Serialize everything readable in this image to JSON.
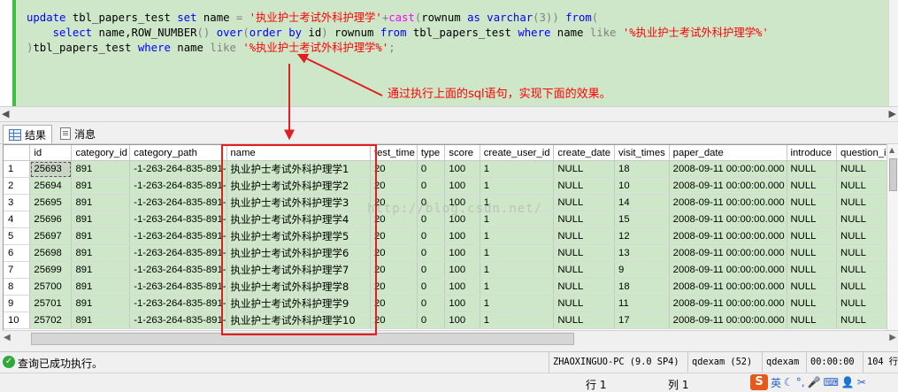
{
  "editor": {
    "line1": {
      "kw_update": "update",
      "table": " tbl_papers_test ",
      "kw_set": "set",
      "name_col": " name ",
      "eq": "=",
      "space": " ",
      "str": "'执业护士考试外科护理学'",
      "plus": "+",
      "fn_cast": "cast",
      "paren_open": "(",
      "rownum": "rownum ",
      "kw_as": "as",
      "varchar_sp": " ",
      "kw_varchar": "varchar",
      "varchar_arg": "(3)) ",
      "kw_from": "from",
      "paren_open2": "("
    },
    "line2": {
      "indent": "    ",
      "kw_select": "select",
      "cols": " name,ROW_NUMBER",
      "parens": "() ",
      "kw_over": "over",
      "p_open": "(",
      "kw_order": "order",
      "sp1": " ",
      "kw_by": "by",
      "id_part": " id",
      "p_close": ")",
      "rownum_alias": " rownum ",
      "kw_from": "from",
      "table": " tbl_papers_test ",
      "kw_where": "where",
      "name_col": " name ",
      "kw_like": "like",
      "sp2": " ",
      "str": "'%执业护士考试外科护理学%'"
    },
    "line3": {
      "p_close": ")",
      "table": "tbl_papers_test ",
      "kw_where": "where",
      "name_col": " name ",
      "kw_like": "like",
      "sp": " ",
      "str": "'%执业护士考试外科护理学%'",
      "semi": ";"
    },
    "annotation": "通过执行上面的sql语句，实现下面的效果。"
  },
  "tabs": {
    "results": "结果",
    "messages": "消息"
  },
  "grid": {
    "columns": [
      "id",
      "category_id",
      "category_path",
      "name",
      "test_time",
      "type",
      "score",
      "create_user_id",
      "create_date",
      "visit_times",
      "paper_date",
      "introduce",
      "question_ids"
    ],
    "rows": [
      [
        "1",
        "25693",
        "891",
        "-1-263-264-835-891-",
        "执业护士考试外科护理学1",
        "20",
        "0",
        "100",
        "1",
        "NULL",
        "18",
        "2008-09-11 00:00:00.000",
        "NULL",
        "NULL"
      ],
      [
        "2",
        "25694",
        "891",
        "-1-263-264-835-891-",
        "执业护士考试外科护理学2",
        "20",
        "0",
        "100",
        "1",
        "NULL",
        "10",
        "2008-09-11 00:00:00.000",
        "NULL",
        "NULL"
      ],
      [
        "3",
        "25695",
        "891",
        "-1-263-264-835-891-",
        "执业护士考试外科护理学3",
        "20",
        "0",
        "100",
        "1",
        "NULL",
        "14",
        "2008-09-11 00:00:00.000",
        "NULL",
        "NULL"
      ],
      [
        "4",
        "25696",
        "891",
        "-1-263-264-835-891-",
        "执业护士考试外科护理学4",
        "20",
        "0",
        "100",
        "1",
        "NULL",
        "15",
        "2008-09-11 00:00:00.000",
        "NULL",
        "NULL"
      ],
      [
        "5",
        "25697",
        "891",
        "-1-263-264-835-891-",
        "执业护士考试外科护理学5",
        "20",
        "0",
        "100",
        "1",
        "NULL",
        "12",
        "2008-09-11 00:00:00.000",
        "NULL",
        "NULL"
      ],
      [
        "6",
        "25698",
        "891",
        "-1-263-264-835-891-",
        "执业护士考试外科护理学6",
        "20",
        "0",
        "100",
        "1",
        "NULL",
        "13",
        "2008-09-11 00:00:00.000",
        "NULL",
        "NULL"
      ],
      [
        "7",
        "25699",
        "891",
        "-1-263-264-835-891-",
        "执业护士考试外科护理学7",
        "20",
        "0",
        "100",
        "1",
        "NULL",
        "9",
        "2008-09-11 00:00:00.000",
        "NULL",
        "NULL"
      ],
      [
        "8",
        "25700",
        "891",
        "-1-263-264-835-891-",
        "执业护士考试外科护理学8",
        "20",
        "0",
        "100",
        "1",
        "NULL",
        "18",
        "2008-09-11 00:00:00.000",
        "NULL",
        "NULL"
      ],
      [
        "9",
        "25701",
        "891",
        "-1-263-264-835-891-",
        "执业护士考试外科护理学9",
        "20",
        "0",
        "100",
        "1",
        "NULL",
        "11",
        "2008-09-11 00:00:00.000",
        "NULL",
        "NULL"
      ],
      [
        "10",
        "25702",
        "891",
        "-1-263-264-835-891-",
        "执业护士考试外科护理学10",
        "20",
        "0",
        "100",
        "1",
        "NULL",
        "17",
        "2008-09-11 00:00:00.000",
        "NULL",
        "NULL"
      ]
    ]
  },
  "watermark": "http://blog.csdn.net/",
  "status": {
    "message": "查询已成功执行。",
    "server": "ZHAOXINGUO-PC (9.0 SP4)",
    "user": "qdexam (52)",
    "db": "qdexam",
    "time": "00:00:00",
    "rows": "104 行"
  },
  "bottom": {
    "line": "行 1",
    "col": "列 1",
    "ime": "英"
  },
  "colors": {
    "editor_bg": "#cfe7c9",
    "result_cell_bg": "#cfe7c9",
    "highlight_box": "#e02020",
    "annotation": "#ff0000"
  }
}
